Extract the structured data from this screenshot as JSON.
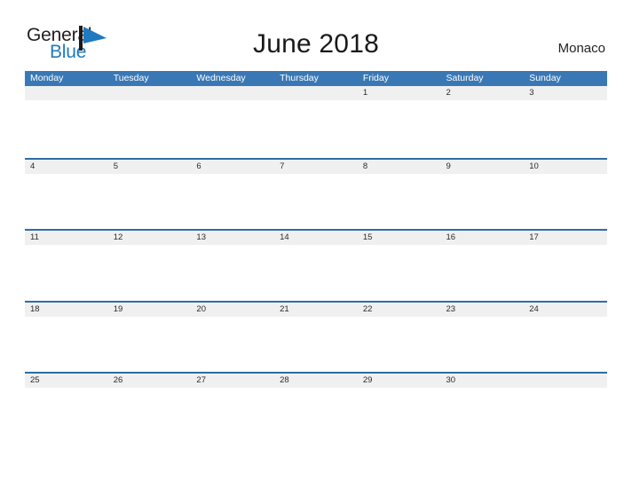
{
  "header": {
    "logo": {
      "text_primary": "General",
      "text_secondary": "Blue",
      "flag_icon": "blue-flag-icon",
      "color_primary": "#231f20",
      "color_secondary": "#1f7ac0"
    },
    "title": "June 2018",
    "region": "Monaco"
  },
  "theme": {
    "header_blue": "#3a78b5",
    "rule_blue": "#2e6da4",
    "date_band_gray": "#f0f0f0",
    "page_background": "#ffffff",
    "weekday_text": "#ffffff",
    "date_text": "#2b2b2b"
  },
  "calendar": {
    "month": "June",
    "year": "2018",
    "weekdays": [
      "Monday",
      "Tuesday",
      "Wednesday",
      "Thursday",
      "Friday",
      "Saturday",
      "Sunday"
    ],
    "weeks": [
      [
        "",
        "",
        "",
        "",
        "1",
        "2",
        "3"
      ],
      [
        "4",
        "5",
        "6",
        "7",
        "8",
        "9",
        "10"
      ],
      [
        "11",
        "12",
        "13",
        "14",
        "15",
        "16",
        "17"
      ],
      [
        "18",
        "19",
        "20",
        "21",
        "22",
        "23",
        "24"
      ],
      [
        "25",
        "26",
        "27",
        "28",
        "29",
        "30",
        ""
      ]
    ]
  }
}
